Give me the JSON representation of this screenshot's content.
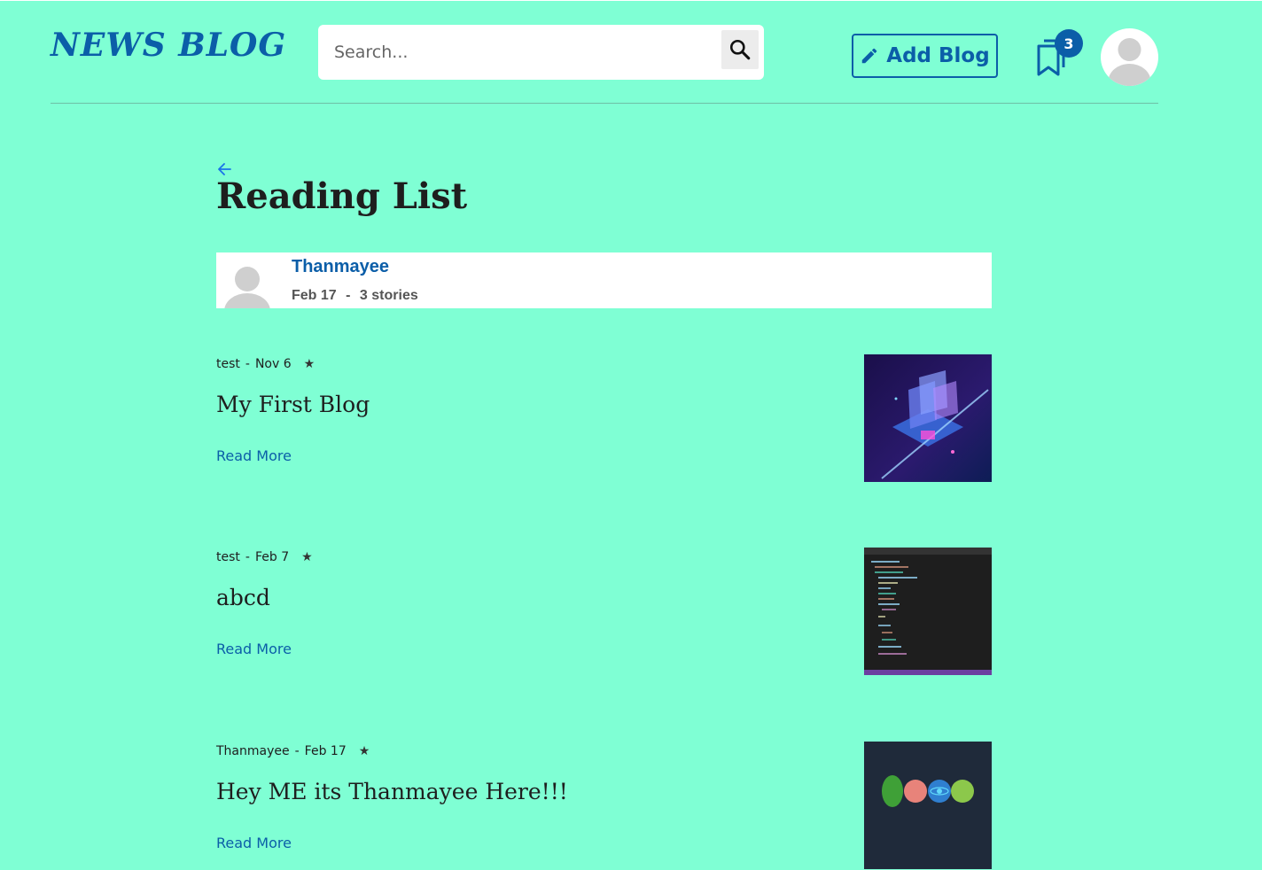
{
  "header": {
    "logo": "NEWS BLOG",
    "search_placeholder": "Search...",
    "add_blog_label": "Add Blog",
    "reading_list_count": "3"
  },
  "page": {
    "title": "Reading List"
  },
  "author": {
    "name": "Thanmayee",
    "date": "Feb 17",
    "separator": "-",
    "stories": "3 stories"
  },
  "posts": [
    {
      "author": "test",
      "separator": "-",
      "date": "Nov 6",
      "title": "My First Blog",
      "read_more": "Read More",
      "thumbnail": "circuit-laptop-image"
    },
    {
      "author": "test",
      "separator": "-",
      "date": "Feb 7",
      "title": "abcd",
      "read_more": "Read More",
      "thumbnail": "code-editor-image"
    },
    {
      "author": "Thanmayee",
      "separator": "-",
      "date": "Feb 17",
      "title": "Hey ME its Thanmayee Here!!!",
      "read_more": "Read More",
      "thumbnail": "mern-logos-image"
    }
  ],
  "colors": {
    "background": "#7fffd4",
    "accent": "#0b5ea8",
    "text": "#1e1e1e"
  },
  "icons": [
    "search-icon",
    "pencil-icon",
    "bookmark-icon",
    "back-arrow-icon",
    "star-icon",
    "avatar-icon"
  ]
}
